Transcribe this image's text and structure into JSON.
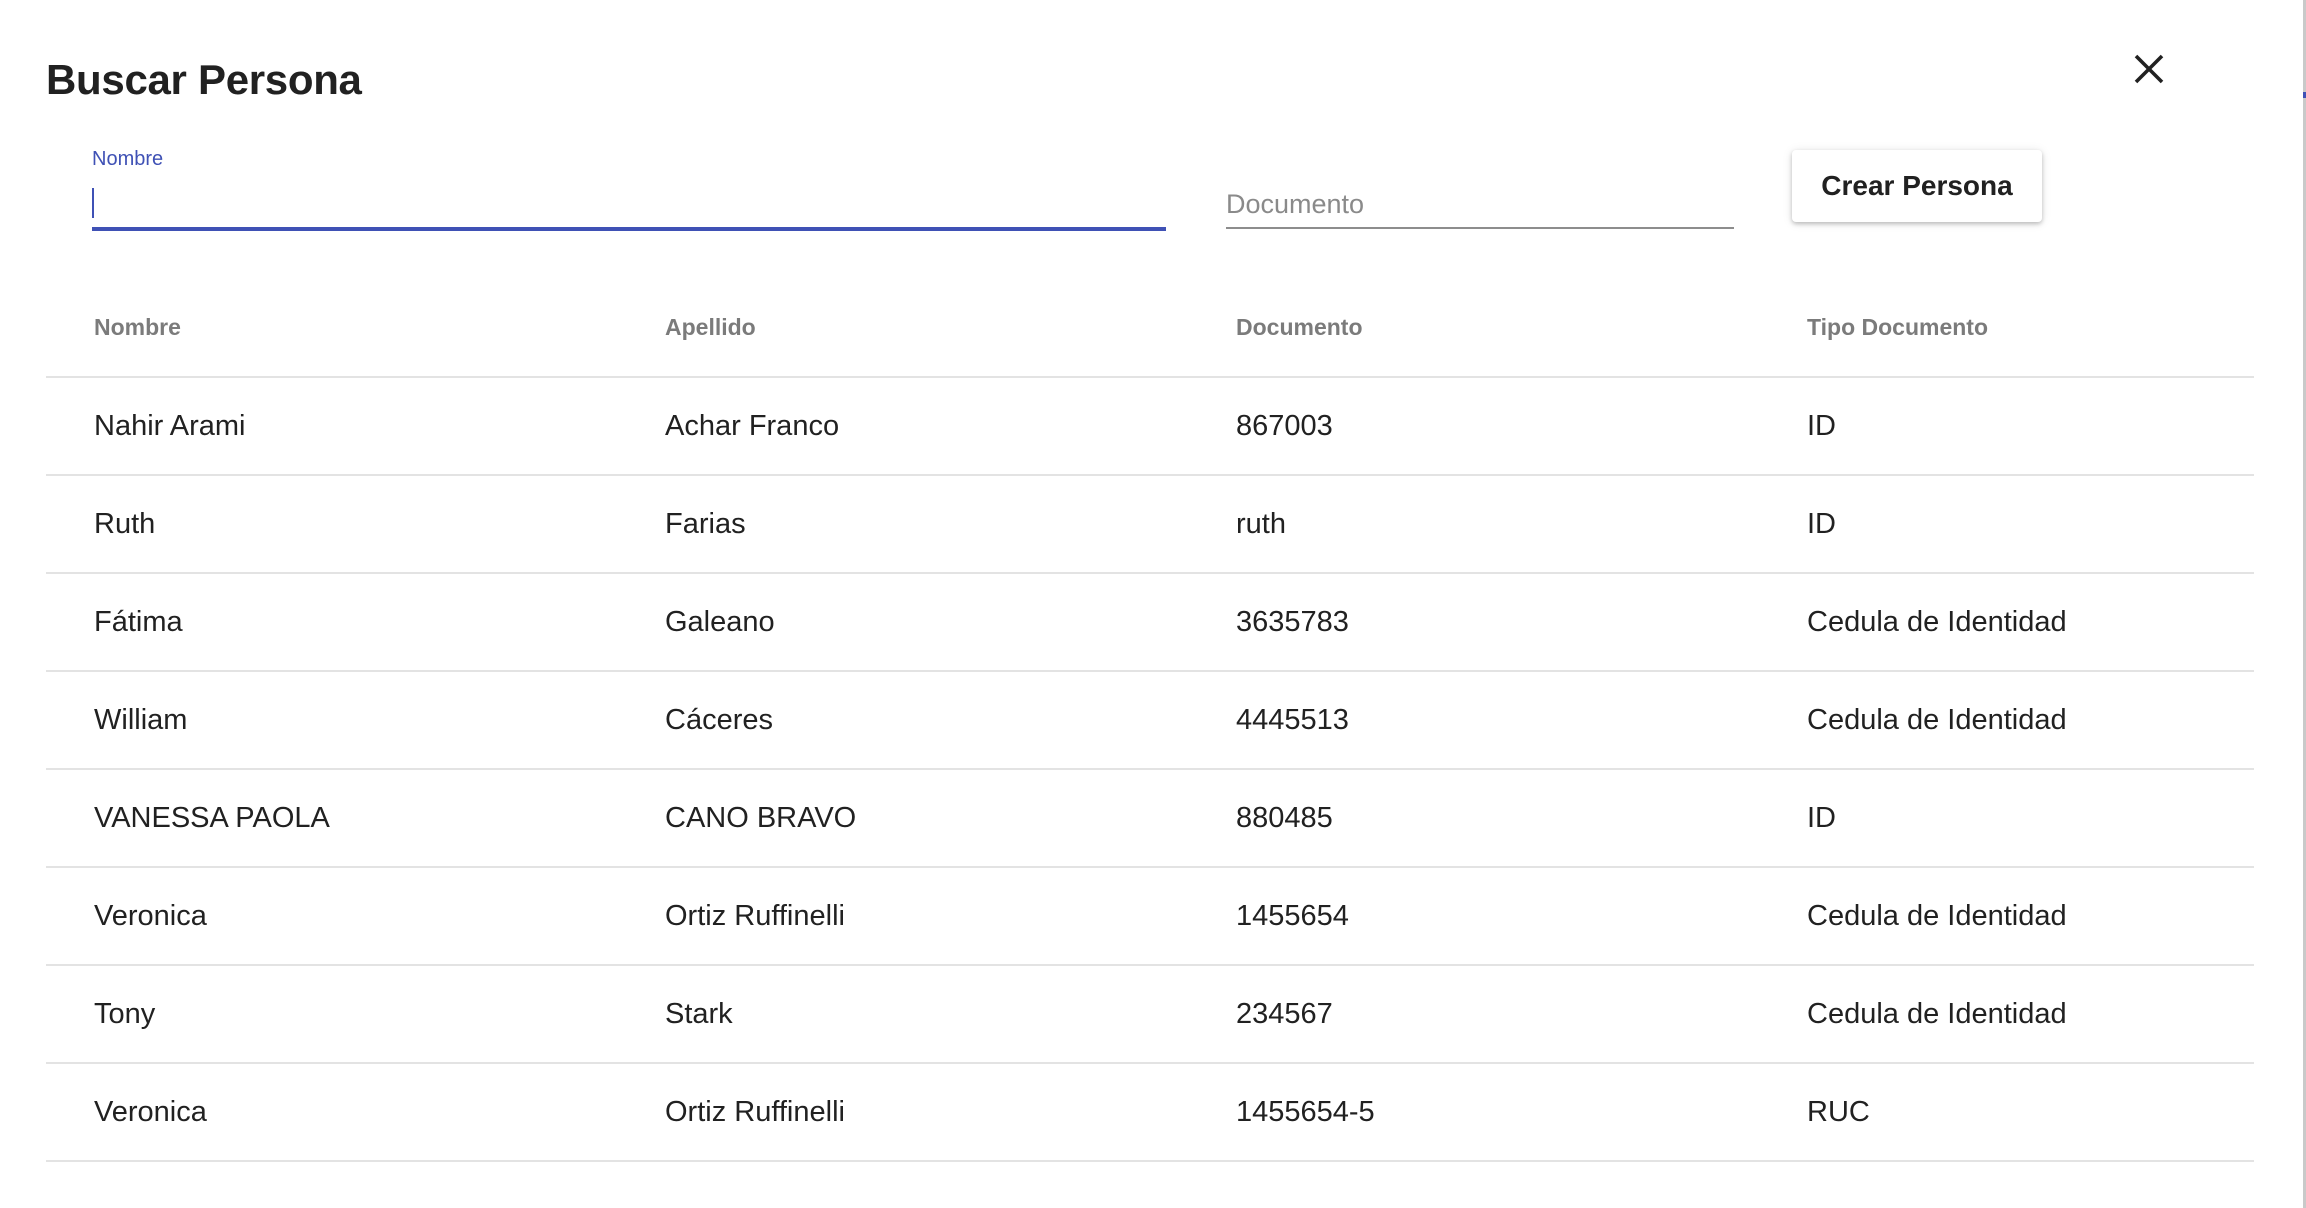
{
  "dialog": {
    "title": "Buscar Persona"
  },
  "filters": {
    "nombre_label": "Nombre",
    "nombre_value": "",
    "documento_placeholder": "Documento",
    "documento_value": ""
  },
  "actions": {
    "create_label": "Crear Persona"
  },
  "colors": {
    "accent": "#3f51b5",
    "header_text": "#7b7b7b",
    "divider": "#e3e3e3"
  },
  "table": {
    "columns": [
      "Nombre",
      "Apellido",
      "Documento",
      "Tipo Documento"
    ],
    "rows": [
      {
        "nombre": "Nahir Arami",
        "apellido": "Achar Franco",
        "documento": "867003",
        "tipo": "ID"
      },
      {
        "nombre": "Ruth",
        "apellido": "Farias",
        "documento": "ruth",
        "tipo": "ID"
      },
      {
        "nombre": "Fátima",
        "apellido": "Galeano",
        "documento": "3635783",
        "tipo": "Cedula de Identidad"
      },
      {
        "nombre": "William",
        "apellido": "Cáceres",
        "documento": "4445513",
        "tipo": "Cedula de Identidad"
      },
      {
        "nombre": "VANESSA PAOLA",
        "apellido": "CANO BRAVO",
        "documento": "880485",
        "tipo": "ID"
      },
      {
        "nombre": "Veronica",
        "apellido": "Ortiz Ruffinelli",
        "documento": "1455654",
        "tipo": "Cedula de Identidad"
      },
      {
        "nombre": "Tony",
        "apellido": "Stark",
        "documento": "234567",
        "tipo": "Cedula de Identidad"
      },
      {
        "nombre": "Veronica",
        "apellido": "Ortiz Ruffinelli",
        "documento": "1455654-5",
        "tipo": "RUC"
      }
    ]
  }
}
